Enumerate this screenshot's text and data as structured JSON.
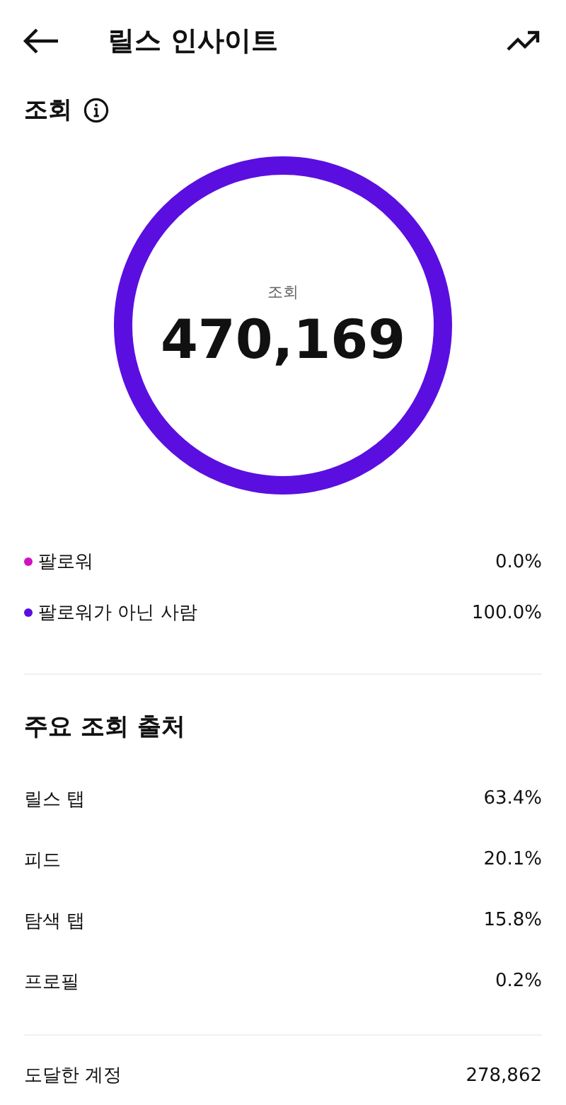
{
  "header": {
    "title": "릴스 인사이트"
  },
  "views": {
    "title": "조회",
    "ring": {
      "label": "조회",
      "value": "470,169"
    },
    "legend": [
      {
        "label": "팔로워",
        "value": "0.0%",
        "color": "#d10fc5"
      },
      {
        "label": "팔로워가 아닌 사람",
        "value": "100.0%",
        "color": "#5a0fe0"
      }
    ]
  },
  "sources": {
    "title": "주요 조회 출처",
    "rows": [
      {
        "label": "릴스 탭",
        "value": "63.4%"
      },
      {
        "label": "피드",
        "value": "20.1%"
      },
      {
        "label": "탐색 탭",
        "value": "15.8%"
      },
      {
        "label": "프로필",
        "value": "0.2%"
      }
    ]
  },
  "reach": {
    "label": "도달한 계정",
    "value": "278,862"
  }
}
